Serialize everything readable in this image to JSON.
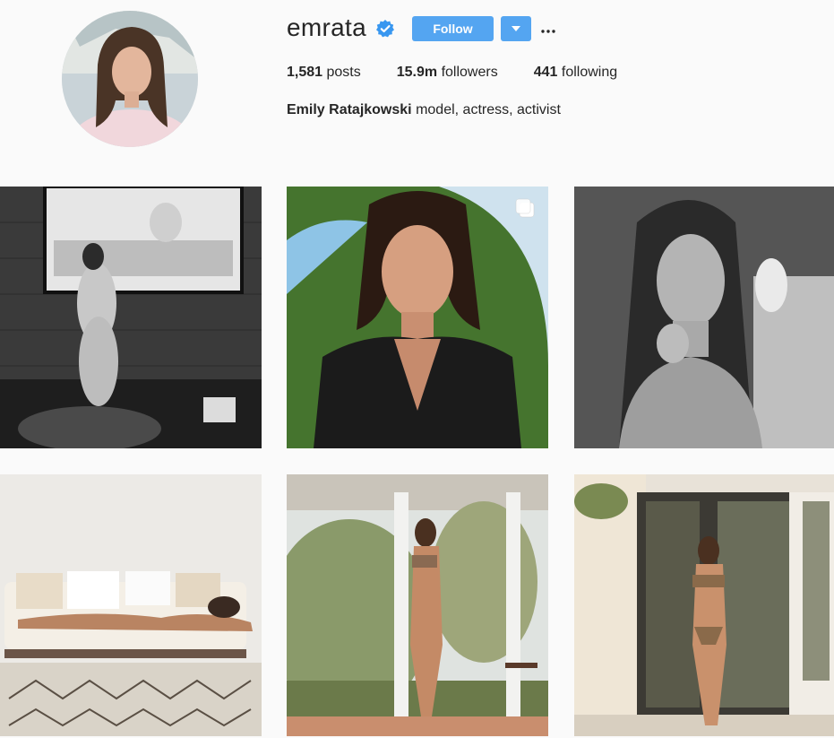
{
  "profile": {
    "username": "emrata",
    "verified_icon": "verified-badge-icon",
    "follow_label": "Follow",
    "dropdown_icon": "chevron-down-icon",
    "more_icon": "more-options-icon",
    "stats": {
      "posts_count": "1,581",
      "posts_label": "posts",
      "followers_count": "15.9m",
      "followers_label": "followers",
      "following_count": "441",
      "following_label": "following"
    },
    "full_name": "Emily Ratajkowski",
    "bio": "model, actress, activist"
  },
  "colors": {
    "background": "#fafafa",
    "accent_blue": "#3897f0",
    "text": "#262626"
  },
  "posts": [
    {
      "type": "photo"
    },
    {
      "type": "multi-photo",
      "icon": "carousel-icon"
    },
    {
      "type": "photo"
    },
    {
      "type": "photo"
    },
    {
      "type": "photo"
    },
    {
      "type": "photo"
    }
  ]
}
